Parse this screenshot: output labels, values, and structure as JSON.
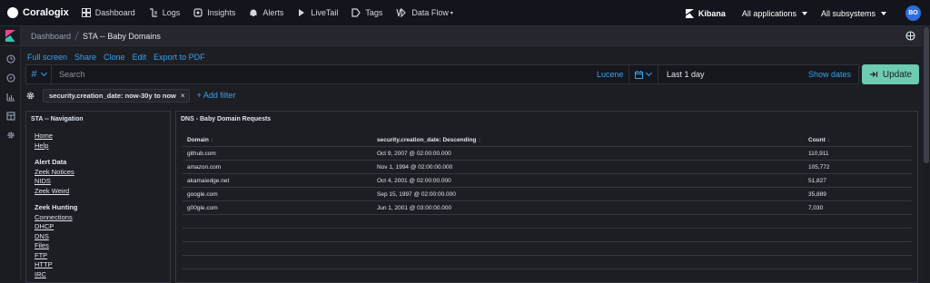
{
  "topbar": {
    "brand": "Coralogix",
    "nav": [
      {
        "label": "Dashboard",
        "icon": "dashboard-icon"
      },
      {
        "label": "Logs",
        "icon": "logs-icon"
      },
      {
        "label": "Insights",
        "icon": "insights-icon"
      },
      {
        "label": "Alerts",
        "icon": "bell-icon"
      },
      {
        "label": "LiveTail",
        "icon": "play-icon"
      },
      {
        "label": "Tags",
        "icon": "tags-icon"
      },
      {
        "label": "Data Flow",
        "icon": "dataflow-icon"
      }
    ],
    "kibana": "Kibana",
    "applications": "All applications",
    "subsystems": "All subsystems",
    "avatar": "BO"
  },
  "breadcrumb": {
    "parent": "Dashboard",
    "current": "STA -- Baby Domains"
  },
  "actions": [
    "Full screen",
    "Share",
    "Clone",
    "Edit",
    "Export to PDF"
  ],
  "query": {
    "type_symbol": "#",
    "search_placeholder": "Search",
    "language": "Lucene",
    "time_range": "Last 1 day",
    "show_dates": "Show dates",
    "update": "Update"
  },
  "filters": {
    "pill": "security.creation_date: now-30y to now",
    "remove": "×",
    "add": "+ Add filter"
  },
  "nav_panel": {
    "title": "STA -- Navigation",
    "top_links": [
      "Home",
      "Help"
    ],
    "alert_heading": "Alert Data",
    "alert_links": [
      "Zeek Notices",
      "NIDS",
      "Zeek Weird"
    ],
    "hunting_heading": "Zeek Hunting",
    "hunting_links": [
      "Connections",
      "DHCP",
      "DNS",
      "Files",
      "FTP",
      "HTTP",
      "IRC"
    ]
  },
  "dns_panel": {
    "title": "DNS - Baby Domain Requests",
    "columns": [
      "Domain",
      "security.creation_date: Descending",
      "Count"
    ],
    "sort_glyph": "↕",
    "rows": [
      [
        "github.com",
        "Oct 9, 2007 @ 02:00:00.000",
        "110,911"
      ],
      [
        "amazon.com",
        "Nov 1, 1994 @ 02:00:00.000",
        "105,772"
      ],
      [
        "akamaiedge.net",
        "Oct 4, 2001 @ 02:00:00.000",
        "51,827"
      ],
      [
        "google.com",
        "Sep 15, 1997 @ 02:00:00.000",
        "35,889"
      ],
      [
        "g00gle.com",
        "Jun 1, 2001 @ 03:00:00.000",
        "7,030"
      ]
    ]
  }
}
